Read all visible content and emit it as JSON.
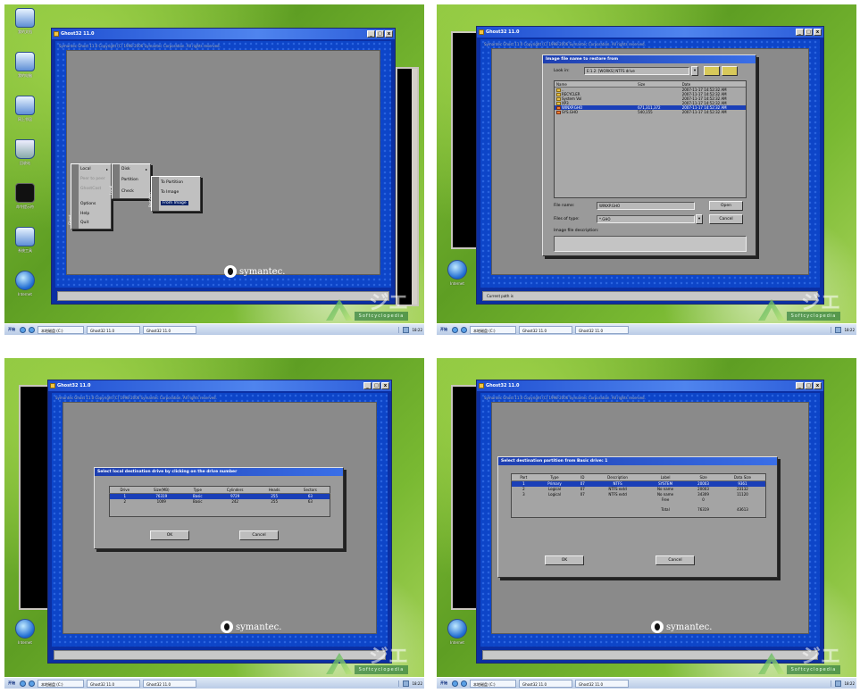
{
  "app_title": "Ghost32 11.0",
  "copyright": "Symantec Ghost 11.0   Copyright (C) 1998-2006 Symantec Corporation. All rights reserved.",
  "brand": "symantec.",
  "window_controls": [
    "_",
    "□",
    "x"
  ],
  "desktop_icons": [
    {
      "icon": "my-documents-icon",
      "label": "我的文档"
    },
    {
      "icon": "my-computer-icon",
      "label": "我的电脑"
    },
    {
      "icon": "network-icon",
      "label": "网上邻居"
    },
    {
      "icon": "recycle-bin-icon",
      "label": "回收站"
    },
    {
      "icon": "terminal-icon",
      "label": "命令提示符"
    },
    {
      "icon": "tools-icon",
      "label": "系统工具"
    },
    {
      "icon": "internet-icon",
      "label": "Internet"
    }
  ],
  "taskbar": {
    "start": "开始",
    "tasks": [
      "本地磁盘 (C:)",
      "Ghost32 11.0",
      "Ghost32 11.0"
    ],
    "time": "18:22"
  },
  "watermark": {
    "big": "ジエ",
    "band": "Softcyclopedia"
  },
  "menus": {
    "main": {
      "side": "Ghost",
      "items": [
        "Local",
        "Peer to peer",
        "GhostCast",
        "Options",
        "Help",
        "Quit"
      ]
    },
    "local": {
      "side": "Local",
      "items": [
        "Disk",
        "Partition",
        "Check"
      ]
    },
    "partition": {
      "side": "Partition",
      "items": [
        "To Partition",
        "To Image",
        "From Image"
      ]
    }
  },
  "open_dialog": {
    "title": "Image file name to restore from",
    "look_in_label": "Look in:",
    "look_in_value": "E:1.2: [WORKS] NTFS drive",
    "columns": [
      "Name",
      "Size",
      "Date"
    ],
    "files": [
      {
        "name": "..",
        "size": "",
        "date": "2007-11-17 14:52:32 AM"
      },
      {
        "name": "RECYCLER",
        "size": "",
        "date": "2007-11-17 14:52:32 AM"
      },
      {
        "name": "System Vol",
        "size": "",
        "date": "2007-11-17 14:52:32 AM"
      },
      {
        "name": "XP3",
        "size": "",
        "date": "2007-11-17 14:52:32 AM"
      },
      {
        "name": "WINXP.GHO",
        "size": "671,311,372",
        "date": "2007-11-17 14:52:32 AM"
      },
      {
        "name": "SYS.GHO",
        "size": "540,155",
        "date": "2007-11-17 14:52:32 AM"
      }
    ],
    "file_name_label": "File name:",
    "file_name_value": "WINXP.GHO",
    "files_type_label": "Files of type:",
    "files_type_value": "*.GHO",
    "description_label": "Image file description:",
    "open_button": "Open",
    "cancel_button": "Cancel"
  },
  "status_bar": {
    "text": "Current path is"
  },
  "drive_dialog": {
    "title": "Select local destination drive by clicking on the drive number",
    "columns": [
      "Drive",
      "Size(MB)",
      "Type",
      "Cylinders",
      "Heads",
      "Sectors"
    ],
    "rows": [
      [
        "1",
        "76319",
        "Basic",
        "9729",
        "255",
        "63"
      ],
      [
        "2",
        "1009",
        "Basic",
        "242",
        "255",
        "63"
      ]
    ],
    "ok_button": "OK",
    "cancel_button": "Cancel"
  },
  "partition_dialog": {
    "title": "Select destination partition from Basic drive: 1",
    "columns": [
      "Part",
      "Type",
      "ID",
      "Description",
      "Label",
      "Size",
      "Data Size"
    ],
    "rows": [
      [
        "1",
        "Primary",
        "07",
        "NTFS",
        "SYSTEM",
        "20003",
        "9361"
      ],
      [
        "2",
        "Logical",
        "07",
        "NTFS extd",
        "No name",
        "20003",
        "23132"
      ],
      [
        "3",
        "Logical",
        "07",
        "NTFS extd",
        "No name",
        "34309",
        "11120"
      ],
      [
        "",
        "",
        "",
        "",
        "Free",
        "0",
        ""
      ],
      [
        "",
        "",
        "",
        "",
        "Total",
        "76319",
        "43613"
      ]
    ],
    "ok_button": "OK",
    "cancel_button": "Cancel"
  }
}
